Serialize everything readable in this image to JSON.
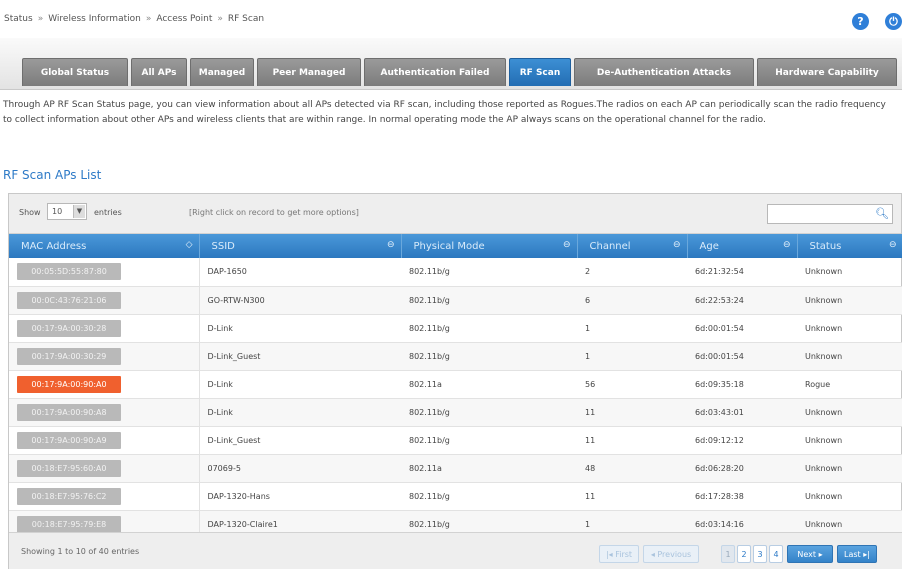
{
  "breadcrumb": [
    "Status",
    "Wireless Information",
    "Access Point",
    "RF Scan"
  ],
  "header_icons": [
    "help-icon",
    "logout-icon"
  ],
  "tabs": [
    {
      "label": "Global Status",
      "active": false
    },
    {
      "label": "All APs",
      "active": false
    },
    {
      "label": "Managed",
      "active": false
    },
    {
      "label": "Peer Managed",
      "active": false
    },
    {
      "label": "Authentication Failed",
      "active": false
    },
    {
      "label": "RF Scan",
      "active": true
    },
    {
      "label": "De-Authentication Attacks",
      "active": false
    },
    {
      "label": "Hardware Capability",
      "active": false
    }
  ],
  "description": "Through AP RF Scan Status page, you can view information about all APs detected via RF scan, including those reported as Rogues.The radios on each AP can periodically scan the radio frequency to collect information about other APs and wireless clients that are within range. In normal operating mode the AP always scans on the operational channel for the radio.",
  "list_title": "RF Scan APs List",
  "toolbar": {
    "show_label": "Show",
    "entries_value": "10",
    "entries_label": "entries",
    "hint": "[Right click on record to get more options]",
    "search_value": ""
  },
  "columns": [
    "MAC Address",
    "SSID",
    "Physical Mode",
    "Channel",
    "Age",
    "Status"
  ],
  "rows": [
    {
      "mac": "00:05:5D:55:87:80",
      "ssid": "DAP-1650",
      "mode": "802.11b/g",
      "channel": "2",
      "age": "6d:21:32:54",
      "status": "Unknown",
      "rogue": false
    },
    {
      "mac": "00:0C:43:76:21:06",
      "ssid": "GO-RTW-N300",
      "mode": "802.11b/g",
      "channel": "6",
      "age": "6d:22:53:24",
      "status": "Unknown",
      "rogue": false
    },
    {
      "mac": "00:17:9A:00:30:28",
      "ssid": "D-Link",
      "mode": "802.11b/g",
      "channel": "1",
      "age": "6d:00:01:54",
      "status": "Unknown",
      "rogue": false
    },
    {
      "mac": "00:17:9A:00:30:29",
      "ssid": "D-Link_Guest",
      "mode": "802.11b/g",
      "channel": "1",
      "age": "6d:00:01:54",
      "status": "Unknown",
      "rogue": false
    },
    {
      "mac": "00:17:9A:00:90:A0",
      "ssid": "D-Link",
      "mode": "802.11a",
      "channel": "56",
      "age": "6d:09:35:18",
      "status": "Rogue",
      "rogue": true
    },
    {
      "mac": "00:17:9A:00:90:A8",
      "ssid": "D-Link",
      "mode": "802.11b/g",
      "channel": "11",
      "age": "6d:03:43:01",
      "status": "Unknown",
      "rogue": false
    },
    {
      "mac": "00:17:9A:00:90:A9",
      "ssid": "D-Link_Guest",
      "mode": "802.11b/g",
      "channel": "11",
      "age": "6d:09:12:12",
      "status": "Unknown",
      "rogue": false
    },
    {
      "mac": "00:18:E7:95:60:A0",
      "ssid": "07069-5",
      "mode": "802.11a",
      "channel": "48",
      "age": "6d:06:28:20",
      "status": "Unknown",
      "rogue": false
    },
    {
      "mac": "00:18:E7:95:76:C2",
      "ssid": "DAP-1320-Hans",
      "mode": "802.11b/g",
      "channel": "11",
      "age": "6d:17:28:38",
      "status": "Unknown",
      "rogue": false
    },
    {
      "mac": "00:18:E7:95:79:E8",
      "ssid": "DAP-1320-Claire1",
      "mode": "802.11b/g",
      "channel": "1",
      "age": "6d:03:14:16",
      "status": "Unknown",
      "rogue": false
    }
  ],
  "footer": {
    "info": "Showing 1 to 10 of 40 entries",
    "pagination": {
      "first": "First",
      "previous": "Previous",
      "pages": [
        "1",
        "2",
        "3",
        "4"
      ],
      "current": "1",
      "next": "Next",
      "last": "Last"
    }
  },
  "colors": {
    "accent": "#2d7ac7",
    "active_tab": "#236db3",
    "rogue": "#f0602e"
  }
}
